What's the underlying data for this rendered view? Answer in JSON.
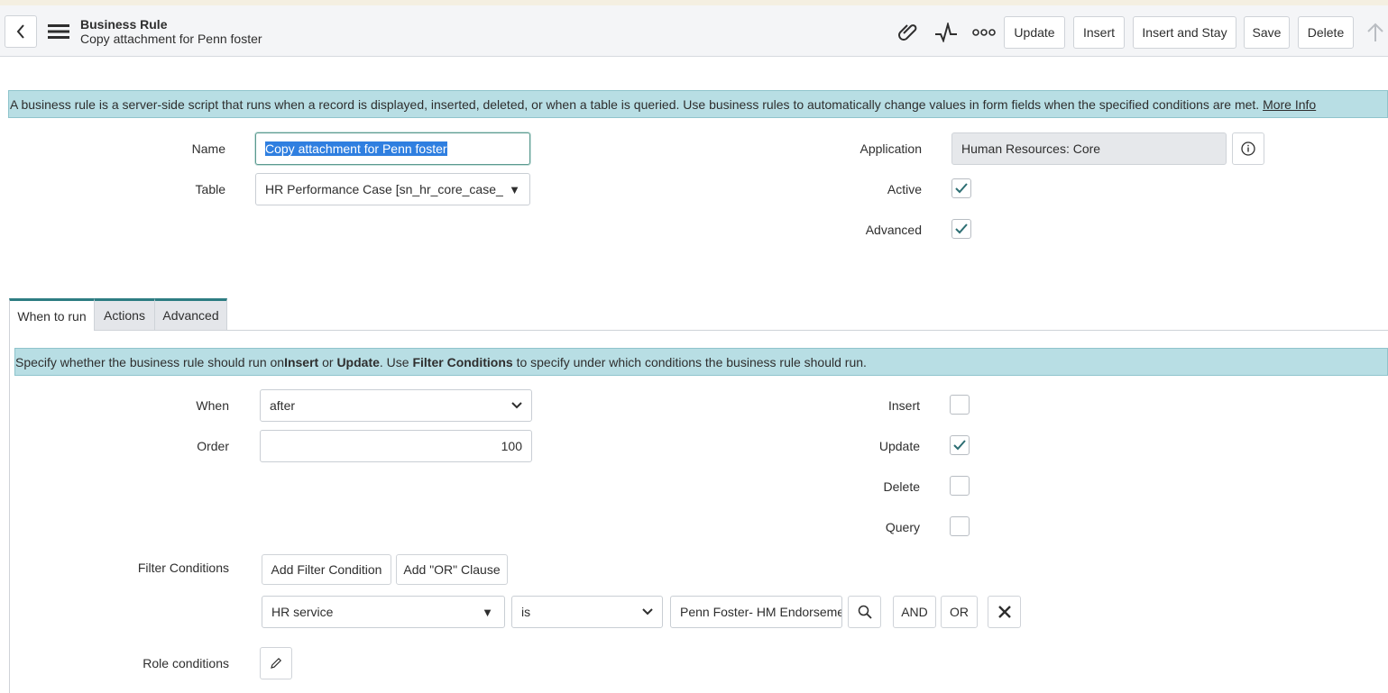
{
  "header": {
    "record_type": "Business Rule",
    "record_name": "Copy attachment for Penn foster",
    "buttons": {
      "update": "Update",
      "insert": "Insert",
      "insert_and_stay": "Insert and Stay",
      "save": "Save",
      "delete": "Delete"
    },
    "icons": [
      "back-icon",
      "menu-icon",
      "paperclip-icon",
      "activity-icon",
      "more-icon",
      "scroll-up-icon"
    ]
  },
  "info_banner": {
    "text": "A business rule is a server-side script that runs when a record is displayed, inserted, deleted, or when a table is queried. Use business rules to automatically change values in form fields when the specified conditions are met.",
    "link": "More Info"
  },
  "form": {
    "name_label": "Name",
    "name_value": "Copy attachment for Penn foster",
    "table_label": "Table",
    "table_value": "HR Performance Case [sn_hr_core_case_...",
    "application_label": "Application",
    "application_value": "Human Resources: Core",
    "active_label": "Active",
    "active_checked": true,
    "advanced_label": "Advanced",
    "advanced_checked": true
  },
  "tabs": [
    "When to run",
    "Actions",
    "Advanced"
  ],
  "when_banner": {
    "part1": "Specify whether the business rule should run on ",
    "insert": "Insert",
    "or": " or ",
    "update": "Update",
    "part2": ". Use ",
    "filter_conditions": "Filter Conditions",
    "part3": " to specify under which conditions the business rule should run."
  },
  "when_to_run": {
    "when_label": "When",
    "when_value": "after",
    "order_label": "Order",
    "order_value": "100",
    "insert_label": "Insert",
    "insert_checked": false,
    "update_label": "Update",
    "update_checked": true,
    "delete_label": "Delete",
    "delete_checked": false,
    "query_label": "Query",
    "query_checked": false,
    "filter_label": "Filter Conditions",
    "add_filter_label": "Add Filter Condition",
    "add_or_label": "Add \"OR\" Clause",
    "condition": {
      "field": "HR service",
      "operator": "is",
      "value": "Penn Foster- HM Endorseme",
      "and_label": "AND",
      "or_label": "OR"
    },
    "role_label": "Role conditions"
  },
  "colors": {
    "accent": "#2d7d82",
    "banner_bg": "#b8dee4",
    "header_bg": "#f4f5f7",
    "selection": "#2f7fe0"
  }
}
